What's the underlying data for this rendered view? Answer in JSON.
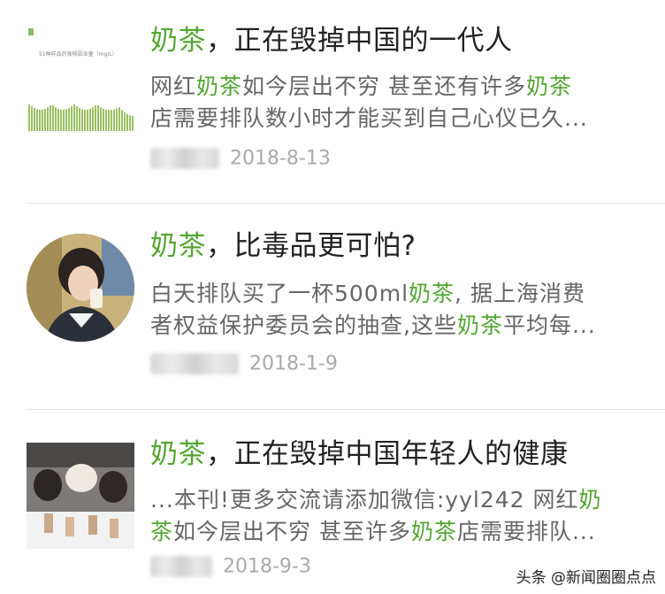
{
  "articles": [
    {
      "title_hl": "奶茶",
      "title_rest": "，正在毁掉中国的一代人",
      "line1": [
        {
          "text": "网红",
          "hl": false
        },
        {
          "text": "奶茶",
          "hl": true
        },
        {
          "text": "如今层出不穷 甚至还有许多",
          "hl": false
        },
        {
          "text": "奶茶",
          "hl": true
        }
      ],
      "line2": [
        {
          "text": "店需要排队数小时才能买到自己心仪已久...",
          "hl": false
        }
      ],
      "date": "2018-8-13",
      "thumb_label": "51种样品的咖啡因含量（mg/L）"
    },
    {
      "title_hl": "奶茶",
      "title_rest": "，比毒品更可怕?",
      "line1": [
        {
          "text": "白天排队买了一杯500ml",
          "hl": false
        },
        {
          "text": "奶茶",
          "hl": true
        },
        {
          "text": ", 据上海消费",
          "hl": false
        }
      ],
      "line2": [
        {
          "text": "者权益保护委员会的抽查,这些",
          "hl": false
        },
        {
          "text": "奶茶",
          "hl": true
        },
        {
          "text": "平均每...",
          "hl": false
        }
      ],
      "date": "2018-1-9"
    },
    {
      "title_hl": "奶茶",
      "title_rest": "，正在毁掉中国年轻人的健康",
      "line1": [
        {
          "text": "...本刊!更多交流请添加微信:yyl242 网红",
          "hl": false
        },
        {
          "text": "奶",
          "hl": true
        }
      ],
      "line2": [
        {
          "text": "茶",
          "hl": true
        },
        {
          "text": "如今层出不穷 甚至许多",
          "hl": false
        },
        {
          "text": "奶茶",
          "hl": true
        },
        {
          "text": "店需要排队...",
          "hl": false
        }
      ],
      "date": "2018-9-3"
    }
  ],
  "watermark": "头条 @新闻圈圈点点",
  "colors": {
    "highlight": "#55a532",
    "title": "#222222",
    "snippet": "#666666",
    "meta": "#aaaaaa"
  }
}
